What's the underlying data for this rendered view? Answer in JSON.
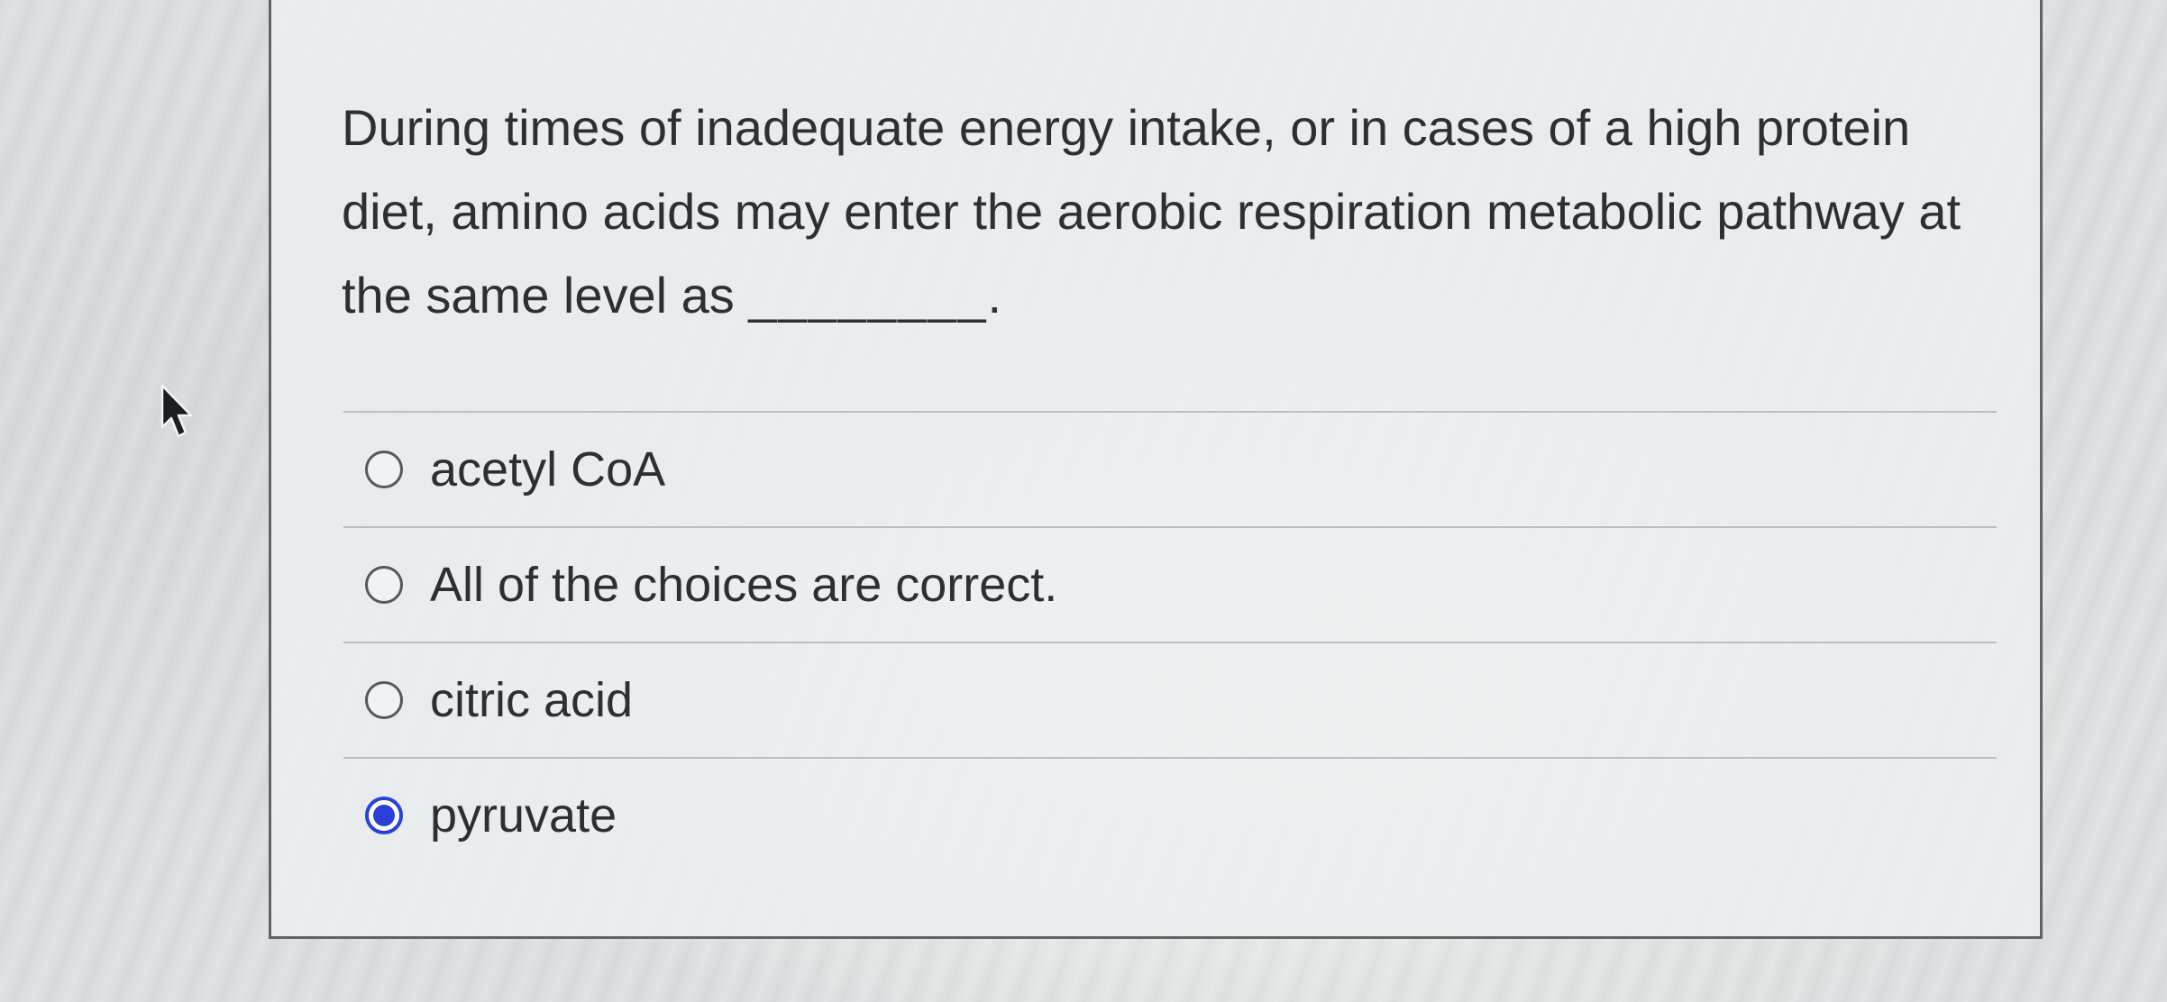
{
  "question": {
    "text": "During times of inadequate energy intake, or in cases of a high protein diet, amino acids may enter the aerobic respiration metabolic pathway at the same level as",
    "blank": "________."
  },
  "answers": [
    {
      "label": "acetyl CoA",
      "selected": false
    },
    {
      "label": "All of the choices are correct.",
      "selected": false
    },
    {
      "label": "citric acid",
      "selected": false
    },
    {
      "label": "pyruvate",
      "selected": true
    }
  ],
  "colors": {
    "selected_radio": "#2b40d8",
    "text": "#2d3033",
    "border": "#5f6468"
  },
  "icons": {
    "cursor": "mouse-pointer-arrow",
    "radio_unselected": "radio-empty-circle",
    "radio_selected": "radio-filled-circle"
  }
}
